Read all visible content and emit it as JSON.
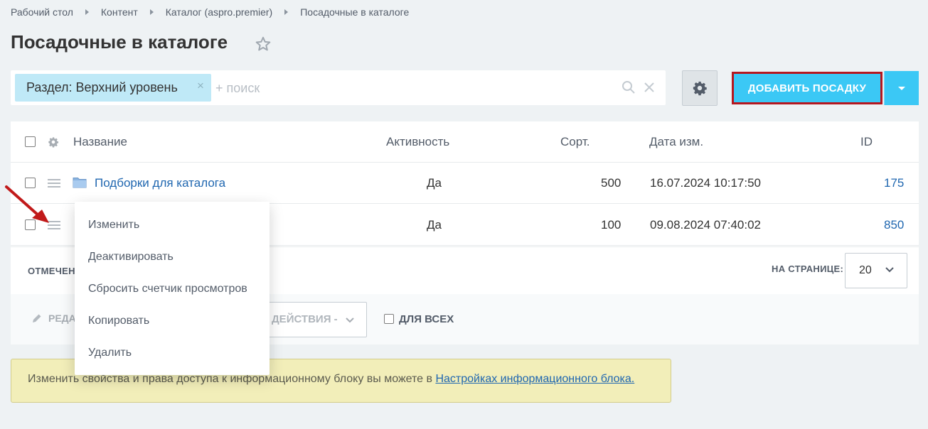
{
  "breadcrumb": [
    "Рабочий стол",
    "Контент",
    "Каталог (aspro.premier)",
    "Посадочные в каталоге"
  ],
  "page_title": "Посадочные в каталоге",
  "filter": {
    "tag": "Раздел: Верхний уровень",
    "tag_remove": "×",
    "search_placeholder": "+ поиск"
  },
  "toolbar": {
    "add_button": "ДОБАВИТЬ ПОСАДКУ"
  },
  "grid": {
    "columns": [
      "Название",
      "Активность",
      "Сорт.",
      "Дата изм.",
      "ID"
    ],
    "rows": [
      {
        "name": "Подборки для каталога",
        "active": "Да",
        "sort": "500",
        "date": "16.07.2024 10:17:50",
        "id": "175"
      },
      {
        "name": "",
        "active": "Да",
        "sort": "100",
        "date": "09.08.2024 07:40:02",
        "id": "850"
      }
    ]
  },
  "footer": {
    "selected_label": "ОТМЕЧЕН",
    "per_page_label": "НА СТРАНИЦЕ:",
    "per_page_value": "20"
  },
  "actions": {
    "edit_label": "РЕДА",
    "select_label": "ДЕЙСТВИЯ -",
    "for_all_label": "ДЛЯ ВСЕХ"
  },
  "context_menu": [
    "Изменить",
    "Деактивировать",
    "Сбросить счетчик просмотров",
    "Копировать",
    "Удалить"
  ],
  "info": {
    "text": "Изменить свойства и права доступа к информационному блоку вы можете в ",
    "link": "Настройках информационного блока."
  },
  "colors": {
    "accent": "#3bc8f5",
    "highlight_border": "#b5171f",
    "link": "#2067b0",
    "info_bg": "#f2eeb9",
    "tag_bg": "#bfe9f7"
  },
  "icons": [
    "star-icon",
    "search-icon",
    "close-icon",
    "gear-icon",
    "drag-handle-icon",
    "folder-icon",
    "chevron-down-icon",
    "pencil-icon",
    "arrow-annotation"
  ]
}
